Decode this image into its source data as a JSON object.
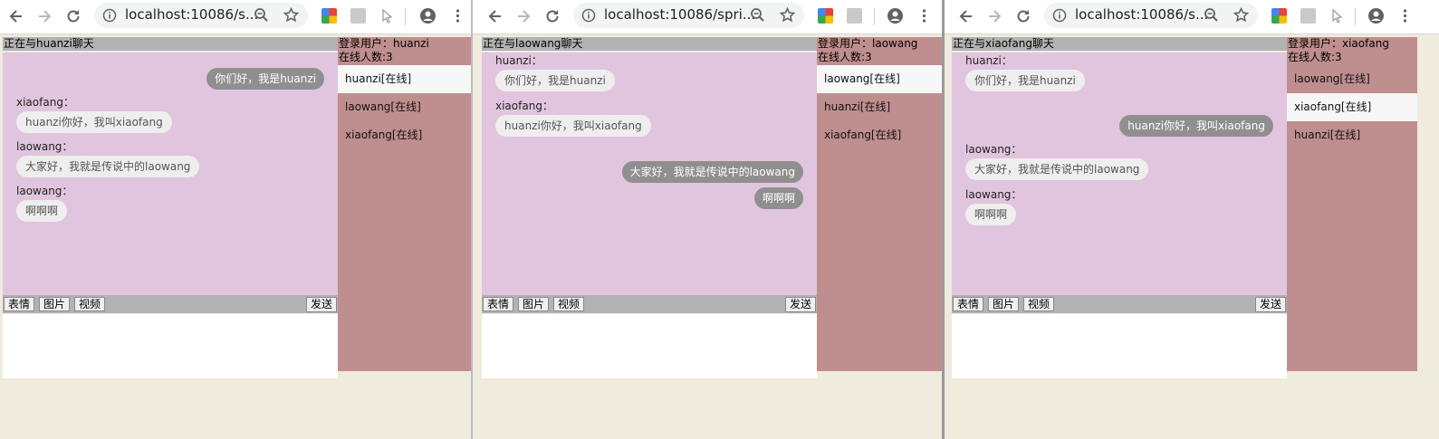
{
  "windows": [
    {
      "url": "localhost:10086/s...",
      "chat_title": "正在与huanzi聊天",
      "login_user": "登录用户：huanzi",
      "online_count": "在线人数:3",
      "users": [
        {
          "label": "huanzi[在线]",
          "active": true
        },
        {
          "label": "laowang[在线]",
          "active": false
        },
        {
          "label": "xiaofang[在线]",
          "active": false
        }
      ],
      "messages": [
        {
          "side": "right",
          "text": "你们好，我是huanzi"
        },
        {
          "side": "left",
          "sender": "xiaofang：",
          "text": "huanzi你好，我叫xiaofang"
        },
        {
          "side": "left",
          "sender": "laowang：",
          "text": "大家好，我就是传说中的laowang"
        },
        {
          "side": "left",
          "sender": "laowang：",
          "text": "啊啊啊"
        }
      ]
    },
    {
      "url": "localhost:10086/spri...",
      "chat_title": "正在与laowang聊天",
      "login_user": "登录用户：laowang",
      "online_count": "在线人数:3",
      "users": [
        {
          "label": "laowang[在线]",
          "active": true
        },
        {
          "label": "huanzi[在线]",
          "active": false
        },
        {
          "label": "xiaofang[在线]",
          "active": false
        }
      ],
      "messages": [
        {
          "side": "left",
          "sender": "huanzi：",
          "text": "你们好，我是huanzi"
        },
        {
          "side": "left",
          "sender": "xiaofang：",
          "text": "huanzi你好，我叫xiaofang"
        },
        {
          "side": "right",
          "text": "大家好，我就是传说中的laowang"
        },
        {
          "side": "right",
          "text": "啊啊啊"
        }
      ]
    },
    {
      "url": "localhost:10086/s...",
      "chat_title": "正在与xiaofang聊天",
      "login_user": "登录用户：xiaofang",
      "online_count": "在线人数:3",
      "users": [
        {
          "label": "laowang[在线]",
          "active": false
        },
        {
          "label": "xiaofang[在线]",
          "active": true
        },
        {
          "label": "huanzi[在线]",
          "active": false
        }
      ],
      "messages": [
        {
          "side": "left",
          "sender": "huanzi：",
          "text": "你们好，我是huanzi"
        },
        {
          "side": "right",
          "text": "huanzi你好，我叫xiaofang"
        },
        {
          "side": "left",
          "sender": "laowang：",
          "text": "大家好，我就是传说中的laowang"
        },
        {
          "side": "left",
          "sender": "laowang：",
          "text": "啊啊啊"
        }
      ]
    }
  ],
  "tools": {
    "emoji": "表情",
    "image": "图片",
    "video": "视频",
    "send": "发送"
  },
  "colors": {
    "chat_background": "#e1c5de",
    "user_panel": "#bf8e8e",
    "bar_gray": "#b2b2b2",
    "own_bubble": "#8f8f8f",
    "other_bubble": "#eeeeee",
    "page_background": "#efebdd"
  }
}
